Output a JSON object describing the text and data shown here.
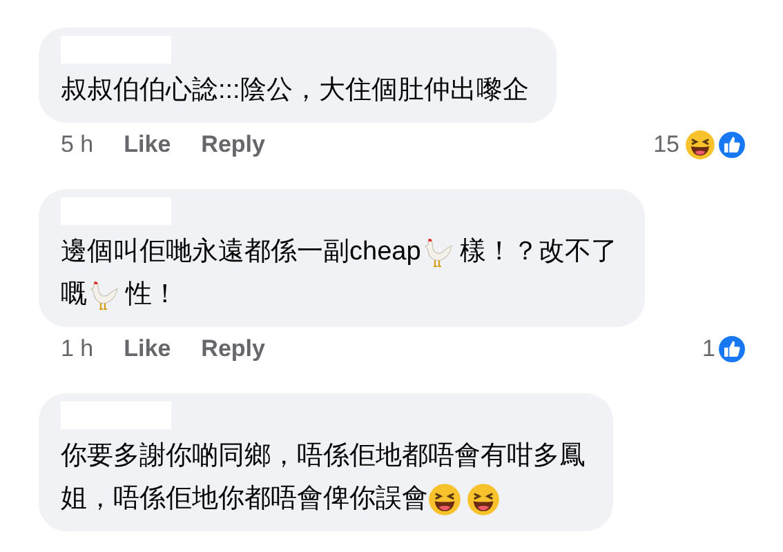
{
  "comments": [
    {
      "lines": [
        [
          {
            "kind": "text",
            "text": "叔叔伯伯心諗:::陰公，大住個肚仲出嚟企"
          }
        ]
      ],
      "time": "5 h",
      "like": "Like",
      "reply": "Reply",
      "reaction_count": "15",
      "reactions": [
        {
          "kind": "haha"
        },
        {
          "kind": "like"
        }
      ]
    },
    {
      "lines": [
        [
          {
            "kind": "text",
            "text": "邊個叫佢哋永遠都係一副cheap"
          },
          {
            "kind": "rooster"
          },
          {
            "kind": "text",
            "text": "樣！？改不了"
          }
        ],
        [
          {
            "kind": "text",
            "text": "嘅"
          },
          {
            "kind": "rooster"
          },
          {
            "kind": "text",
            "text": "性！"
          }
        ]
      ],
      "time": "1 h",
      "like": "Like",
      "reply": "Reply",
      "reaction_count": "1",
      "reactions": [
        {
          "kind": "like"
        }
      ]
    },
    {
      "lines": [
        [
          {
            "kind": "text",
            "text": "你要多謝你啲同鄉，唔係佢地都唔會有咁多鳳"
          }
        ],
        [
          {
            "kind": "text",
            "text": "姐，唔係佢地你都唔會俾你誤會"
          },
          {
            "kind": "laugh"
          },
          {
            "kind": "laugh"
          }
        ]
      ]
    }
  ]
}
